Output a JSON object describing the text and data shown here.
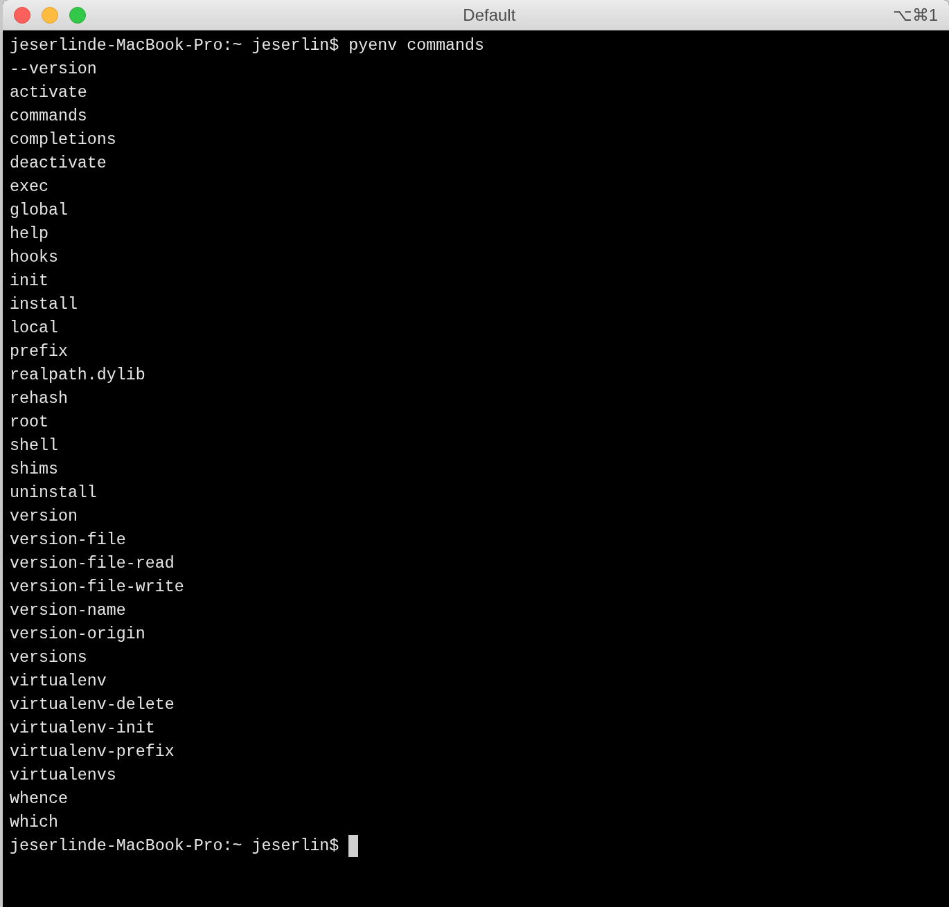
{
  "window": {
    "title": "Default",
    "shortcut": "⌥⌘1"
  },
  "terminal": {
    "lines": [
      "jeserlinde-MacBook-Pro:~ jeserlin$ pyenv commands",
      "--version",
      "activate",
      "commands",
      "completions",
      "deactivate",
      "exec",
      "global",
      "help",
      "hooks",
      "init",
      "install",
      "local",
      "prefix",
      "realpath.dylib",
      "rehash",
      "root",
      "shell",
      "shims",
      "uninstall",
      "version",
      "version-file",
      "version-file-read",
      "version-file-write",
      "version-name",
      "version-origin",
      "versions",
      "virtualenv",
      "virtualenv-delete",
      "virtualenv-init",
      "virtualenv-prefix",
      "virtualenvs",
      "whence",
      "which"
    ],
    "prompt": "jeserlinde-MacBook-Pro:~ jeserlin$ "
  }
}
